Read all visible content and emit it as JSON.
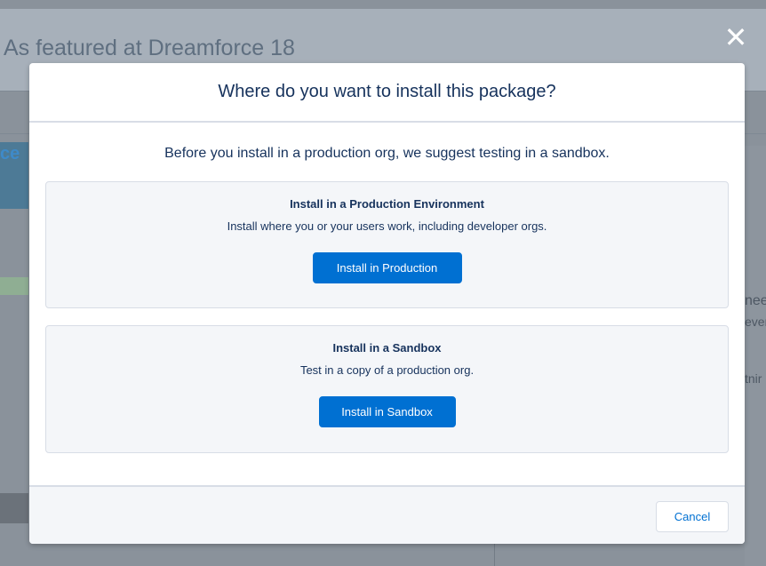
{
  "background": {
    "page_title": "As featured at Dreamforce 18",
    "left_fragment": "ce",
    "right_fragments": [
      "nee",
      "ever",
      "tnir"
    ]
  },
  "modal": {
    "title": "Where do you want to install this package?",
    "intro": "Before you install in a production org, we suggest testing in a sandbox.",
    "options": [
      {
        "title": "Install in a Production Environment",
        "description": "Install where you or your users work, including developer orgs.",
        "button_label": "Install in Production"
      },
      {
        "title": "Install in a Sandbox",
        "description": "Test in a copy of a production org.",
        "button_label": "Install in Sandbox"
      }
    ],
    "cancel_label": "Cancel",
    "close_icon": "close-icon"
  },
  "colors": {
    "brand_blue": "#0070d2",
    "heading_navy": "#16325c",
    "card_bg": "#f4f6f9",
    "border": "#d8dde6"
  }
}
